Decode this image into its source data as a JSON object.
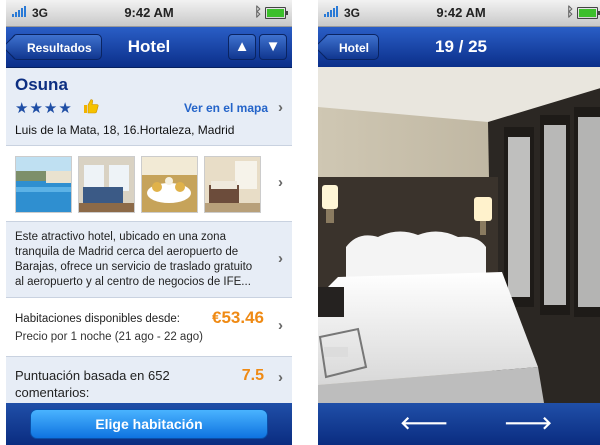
{
  "left": {
    "status": {
      "carrier": "3G",
      "time": "9:42 AM"
    },
    "nav": {
      "back_label": "Resultados",
      "title": "Hotel",
      "up_icon": "▲",
      "down_icon": "▼"
    },
    "hotel": {
      "name": "Osuna",
      "stars": "★★★★",
      "map_link": "Ver en el mapa",
      "address": "Luis de la Mata, 18, 16.Hortaleza, Madrid"
    },
    "description": "Este atractivo hotel, ubicado en una zona tranquila de Madrid cerca del aeropuerto de Barajas, ofrece un servicio de traslado gratuito al aeropuerto y al centro de negocios de IFE...",
    "price": {
      "label": "Habitaciones disponibles desde:",
      "amount": "€53.46",
      "detail": "Precio por 1 noche (21 ago - 22 ago)"
    },
    "rating": {
      "label": "Puntuación basada en 652 comentarios:",
      "score": "7.5"
    },
    "button_label": "Elige habitación"
  },
  "right": {
    "status": {
      "carrier": "3G",
      "time": "9:42 AM"
    },
    "nav": {
      "back_label": "Hotel",
      "counter": "19 / 25"
    },
    "prev_icon": "🡐",
    "next_icon": "🡒"
  },
  "colors": {
    "nav": "#0b2f8a",
    "price": "#ef8a14",
    "link": "#2464c9",
    "section": "#e7edf6"
  },
  "icons": [
    "signal-icon",
    "bluetooth-icon",
    "battery-icon",
    "star-icon",
    "thumbs-up-icon",
    "chevron-right-icon",
    "arrow-up-icon",
    "arrow-down-icon",
    "arrow-left-icon",
    "arrow-right-icon"
  ]
}
